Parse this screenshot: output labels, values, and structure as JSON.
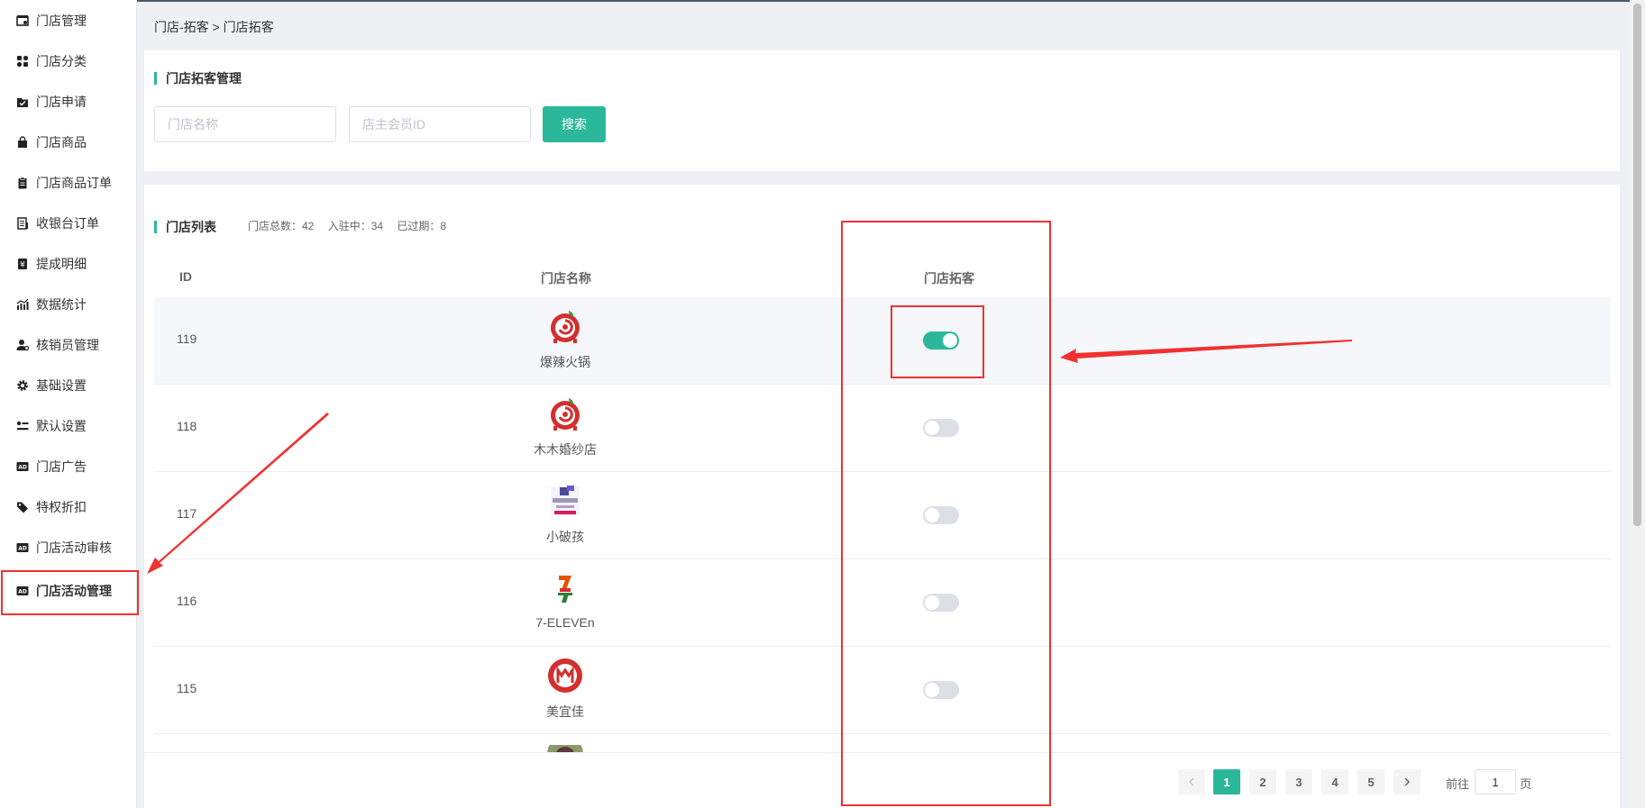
{
  "sidebar": {
    "items": [
      {
        "label": "门店管理",
        "icon": "store-icon"
      },
      {
        "label": "门店分类",
        "icon": "category-icon"
      },
      {
        "label": "门店申请",
        "icon": "folder-check-icon"
      },
      {
        "label": "门店商品",
        "icon": "bag-icon"
      },
      {
        "label": "门店商品订单",
        "icon": "clipboard-icon"
      },
      {
        "label": "收银台订单",
        "icon": "receipt-icon"
      },
      {
        "label": "提成明细",
        "icon": "yen-icon"
      },
      {
        "label": "数据统计",
        "icon": "chart-icon"
      },
      {
        "label": "核销员管理",
        "icon": "user-gear-icon"
      },
      {
        "label": "基础设置",
        "icon": "gear-icon"
      },
      {
        "label": "默认设置",
        "icon": "settings-list-icon"
      },
      {
        "label": "门店广告",
        "icon": "ad-icon"
      },
      {
        "label": "特权折扣",
        "icon": "tag-icon"
      },
      {
        "label": "门店活动审核",
        "icon": "ad-icon"
      },
      {
        "label": "门店活动管理",
        "icon": "ad-icon"
      }
    ],
    "active_index": 14
  },
  "breadcrumb": "门店-拓客 > 门店拓客",
  "search": {
    "title": "门店拓客管理",
    "name_placeholder": "门店名称",
    "member_placeholder": "店主会员ID",
    "button_label": "搜索"
  },
  "list": {
    "title": "门店列表",
    "stats": {
      "total": "门店总数：42",
      "active": "入驻中：34",
      "expired": "已过期：8"
    },
    "columns": {
      "id": "ID",
      "name": "门店名称",
      "tuoke": "门店拓客"
    },
    "rows": [
      {
        "id": "119",
        "name": "爆辣火锅",
        "logo": "hotpot-logo",
        "enabled": true
      },
      {
        "id": "118",
        "name": "木木婚纱店",
        "logo": "hotpot-logo",
        "enabled": false
      },
      {
        "id": "117",
        "name": "小破孩",
        "logo": "kids-logo",
        "enabled": false
      },
      {
        "id": "116",
        "name": "7-ELEVEn",
        "logo": "seven-eleven-logo",
        "enabled": false
      },
      {
        "id": "115",
        "name": "美宜佳",
        "logo": "meiyijia-logo",
        "enabled": false
      }
    ]
  },
  "pagination": {
    "pages": [
      "1",
      "2",
      "3",
      "4",
      "5"
    ],
    "current": "1",
    "goto_prefix": "前往",
    "goto_value": "1",
    "goto_suffix": "页"
  },
  "colors": {
    "accent": "#2bb89a",
    "annotation": "#f23030"
  }
}
